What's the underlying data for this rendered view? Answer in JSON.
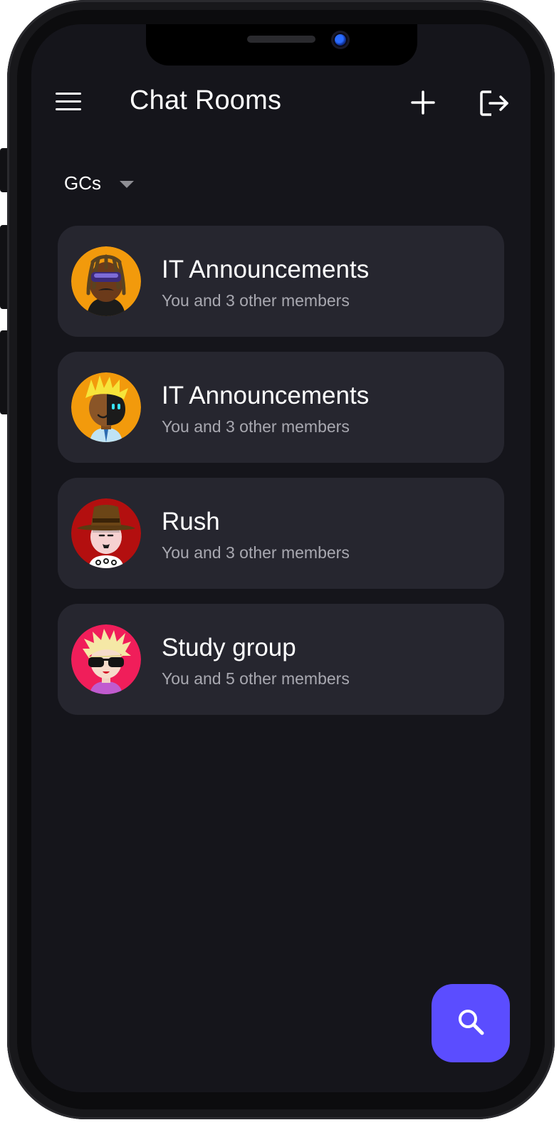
{
  "header": {
    "title": "Chat Rooms"
  },
  "filter": {
    "selected": "GCs"
  },
  "rooms": [
    {
      "name": "IT Announcements",
      "subtitle": "You and 3 other members",
      "avatar": "dreadlocks-sunglasses-avatar"
    },
    {
      "name": "IT Announcements",
      "subtitle": "You and 3 other members",
      "avatar": "blond-robot-eye-avatar"
    },
    {
      "name": "Rush",
      "subtitle": "You and 3 other members",
      "avatar": "cowboy-hat-avatar"
    },
    {
      "name": "Study group",
      "subtitle": "You and 5 other members",
      "avatar": "spiky-hair-sunglasses-avatar"
    }
  ],
  "icons": {
    "menu": "menu-icon",
    "add": "plus-icon",
    "logout": "logout-icon",
    "search": "search-icon",
    "dropdown": "caret-down-icon"
  },
  "colors": {
    "screen_bg": "#15151b",
    "card_bg": "#26262f",
    "accent": "#5b4dff",
    "subtitle": "#a8a8b0"
  }
}
